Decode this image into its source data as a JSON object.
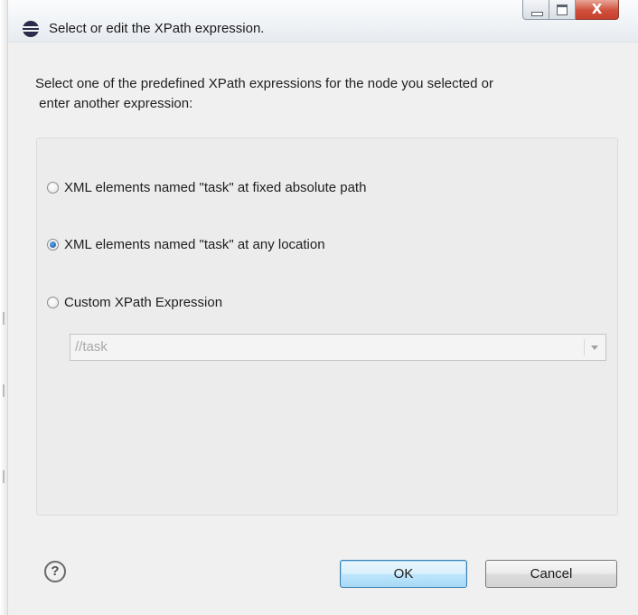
{
  "window": {
    "title": "Select or edit the XPath expression.",
    "controls": {
      "minimize_icon": "minimize-icon",
      "maximize_icon": "maximize-icon",
      "close_glyph": "X"
    }
  },
  "instructions": "Select one of the predefined XPath expressions for the node you selected or\n enter another expression:",
  "options": [
    {
      "label": "XML elements named \"task\" at fixed absolute path",
      "checked": false
    },
    {
      "label": "XML elements named \"task\" at any location",
      "checked": true
    },
    {
      "label": "Custom XPath Expression",
      "checked": false
    }
  ],
  "xpath_combo": {
    "value": "//task",
    "enabled": false
  },
  "footer": {
    "help_glyph": "?",
    "ok_label": "OK",
    "cancel_label": "Cancel"
  }
}
